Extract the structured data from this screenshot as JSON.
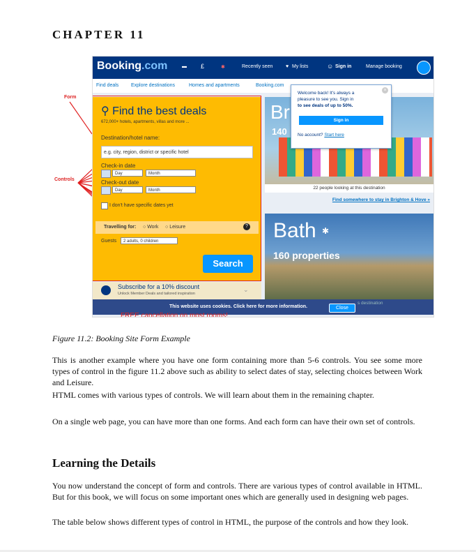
{
  "chapter": "CHAPTER 11",
  "figure": {
    "annotations": {
      "form": "Form",
      "controls": "Controls"
    },
    "topbar": {
      "logo_main": "Booking",
      "logo_dot": ".com",
      "currency": "£",
      "recent": "Recently seen",
      "lists": "My lists",
      "signin": "Sign in",
      "manage": "Manage booking"
    },
    "subnav": [
      "Find deals",
      "Explore destinations",
      "Homes and apartments",
      "Booking.com"
    ],
    "form": {
      "title": "Find the best deals",
      "subtitle": "672,000+ hotels, apartments, villas and more ...",
      "dest_label": "Destination/hotel name:",
      "dest_placeholder": "e.g. city, region, district or specific hotel",
      "checkin_label": "Check-in date",
      "checkout_label": "Check-out date",
      "day": "Day",
      "month": "Month",
      "no_dates": "I don't have specific dates yet",
      "travelling": "Travelling for:",
      "work": "Work",
      "leisure": "Leisure",
      "guests_label": "Guests",
      "guests_value": "2 adults, 0 children",
      "search": "Search"
    },
    "subscribe": {
      "title": "Subscribe for a 10% discount",
      "sub": "Unlock Member Deals and tailored inspiration"
    },
    "cookie": {
      "text": "This website uses cookies. Click here for more information.",
      "close": "Close",
      "behind": "s destination"
    },
    "free": "FREE cancellation on most rooms!",
    "popup": {
      "line1": "Welcome back! It's always a",
      "line2": "pleasure to see you. Sign in",
      "line3": "to see deals of up to 50%.",
      "btn": "Sign in",
      "no_account": "No account?",
      "start": "Start here"
    },
    "city1": {
      "name": "Br",
      "count": "140"
    },
    "looking": "22 people looking at this destination",
    "find_link": "Find somewhere to stay in Brighton & Hove »",
    "city2": {
      "name": "Bath",
      "count": "160 properties"
    }
  },
  "caption": "Figure 11.2: Booking Site Form Example",
  "paragraphs": [
    "This is another example where you have one form containing more than 5-6 controls. You see some more types of control in the figure 11.2 above such as ability to select dates of stay, selecting choices between Work and Leisure.",
    "HTML comes with various types of controls. We will learn about them in the remaining chapter.",
    "On a single web page, you can have more than one forms. And each form can have their own set of controls."
  ],
  "heading": "Learning the Details",
  "paragraphs2": [
    "You now understand the concept of form and controls. There are various types of control available in HTML. But for this book, we will focus on some important ones which are generally used in designing web pages.",
    "The table below shows different types of control in HTML, the purpose of the controls and how they look."
  ],
  "colors": {
    "navy": "#003580",
    "yellow": "#febb02",
    "blue": "#0896ff",
    "red": "#e02020"
  }
}
